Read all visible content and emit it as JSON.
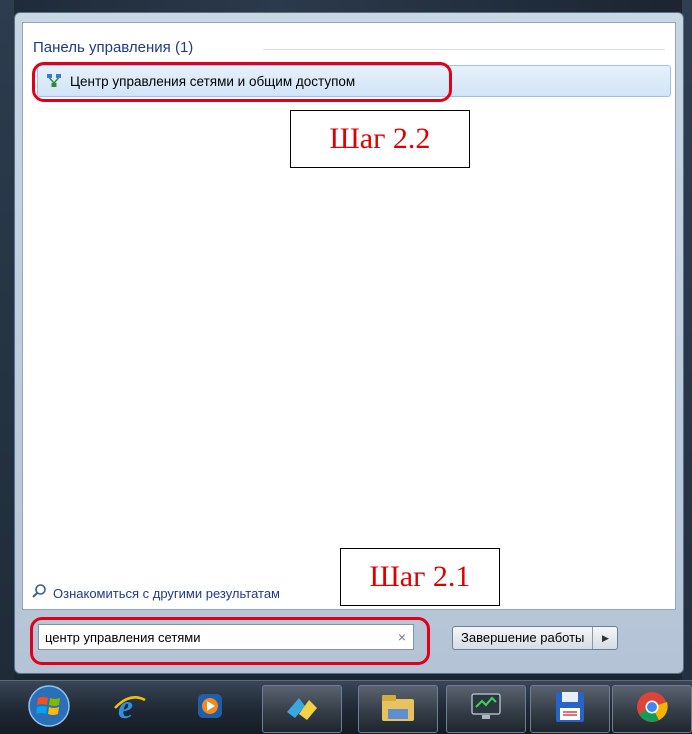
{
  "start_menu": {
    "section_title": "Панель управления (1)",
    "result_item_label": "Центр управления сетями и общим доступом",
    "more_results_label": "Ознакомиться с другими результатам"
  },
  "search": {
    "value": "центр управления сетями",
    "clear_glyph": "×"
  },
  "shutdown": {
    "label": "Завершение работы",
    "arrow_glyph": "▶"
  },
  "annotations": {
    "step_2_2": "Шаг 2.2",
    "step_2_1": "Шаг 2.1",
    "highlight_color": "#e0001a"
  },
  "taskbar": {
    "items": [
      {
        "icon": "windows-start-orb-icon"
      },
      {
        "icon": "internet-explorer-icon"
      },
      {
        "icon": "media-player-icon"
      },
      {
        "icon": "windows-live-icon"
      },
      {
        "icon": "file-explorer-icon"
      },
      {
        "icon": "remote-desktop-monitor-icon"
      },
      {
        "icon": "save-disk-icon"
      },
      {
        "icon": "chrome-icon"
      }
    ]
  }
}
